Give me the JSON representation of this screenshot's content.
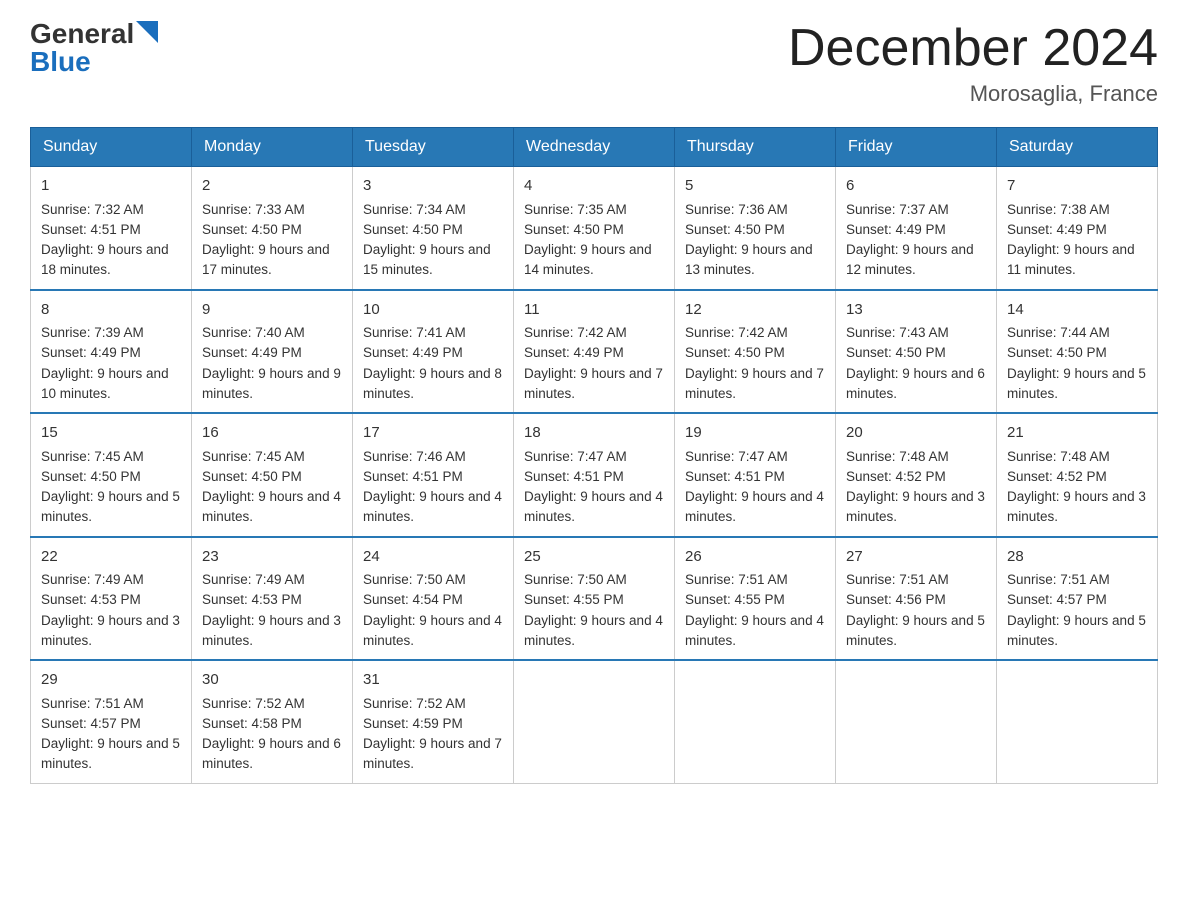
{
  "header": {
    "logo_general": "General",
    "logo_blue": "Blue",
    "month_title": "December 2024",
    "location": "Morosaglia, France"
  },
  "days_of_week": [
    "Sunday",
    "Monday",
    "Tuesday",
    "Wednesday",
    "Thursday",
    "Friday",
    "Saturday"
  ],
  "weeks": [
    [
      {
        "day": "1",
        "sunrise": "7:32 AM",
        "sunset": "4:51 PM",
        "daylight": "9 hours and 18 minutes."
      },
      {
        "day": "2",
        "sunrise": "7:33 AM",
        "sunset": "4:50 PM",
        "daylight": "9 hours and 17 minutes."
      },
      {
        "day": "3",
        "sunrise": "7:34 AM",
        "sunset": "4:50 PM",
        "daylight": "9 hours and 15 minutes."
      },
      {
        "day": "4",
        "sunrise": "7:35 AM",
        "sunset": "4:50 PM",
        "daylight": "9 hours and 14 minutes."
      },
      {
        "day": "5",
        "sunrise": "7:36 AM",
        "sunset": "4:50 PM",
        "daylight": "9 hours and 13 minutes."
      },
      {
        "day": "6",
        "sunrise": "7:37 AM",
        "sunset": "4:49 PM",
        "daylight": "9 hours and 12 minutes."
      },
      {
        "day": "7",
        "sunrise": "7:38 AM",
        "sunset": "4:49 PM",
        "daylight": "9 hours and 11 minutes."
      }
    ],
    [
      {
        "day": "8",
        "sunrise": "7:39 AM",
        "sunset": "4:49 PM",
        "daylight": "9 hours and 10 minutes."
      },
      {
        "day": "9",
        "sunrise": "7:40 AM",
        "sunset": "4:49 PM",
        "daylight": "9 hours and 9 minutes."
      },
      {
        "day": "10",
        "sunrise": "7:41 AM",
        "sunset": "4:49 PM",
        "daylight": "9 hours and 8 minutes."
      },
      {
        "day": "11",
        "sunrise": "7:42 AM",
        "sunset": "4:49 PM",
        "daylight": "9 hours and 7 minutes."
      },
      {
        "day": "12",
        "sunrise": "7:42 AM",
        "sunset": "4:50 PM",
        "daylight": "9 hours and 7 minutes."
      },
      {
        "day": "13",
        "sunrise": "7:43 AM",
        "sunset": "4:50 PM",
        "daylight": "9 hours and 6 minutes."
      },
      {
        "day": "14",
        "sunrise": "7:44 AM",
        "sunset": "4:50 PM",
        "daylight": "9 hours and 5 minutes."
      }
    ],
    [
      {
        "day": "15",
        "sunrise": "7:45 AM",
        "sunset": "4:50 PM",
        "daylight": "9 hours and 5 minutes."
      },
      {
        "day": "16",
        "sunrise": "7:45 AM",
        "sunset": "4:50 PM",
        "daylight": "9 hours and 4 minutes."
      },
      {
        "day": "17",
        "sunrise": "7:46 AM",
        "sunset": "4:51 PM",
        "daylight": "9 hours and 4 minutes."
      },
      {
        "day": "18",
        "sunrise": "7:47 AM",
        "sunset": "4:51 PM",
        "daylight": "9 hours and 4 minutes."
      },
      {
        "day": "19",
        "sunrise": "7:47 AM",
        "sunset": "4:51 PM",
        "daylight": "9 hours and 4 minutes."
      },
      {
        "day": "20",
        "sunrise": "7:48 AM",
        "sunset": "4:52 PM",
        "daylight": "9 hours and 3 minutes."
      },
      {
        "day": "21",
        "sunrise": "7:48 AM",
        "sunset": "4:52 PM",
        "daylight": "9 hours and 3 minutes."
      }
    ],
    [
      {
        "day": "22",
        "sunrise": "7:49 AM",
        "sunset": "4:53 PM",
        "daylight": "9 hours and 3 minutes."
      },
      {
        "day": "23",
        "sunrise": "7:49 AM",
        "sunset": "4:53 PM",
        "daylight": "9 hours and 3 minutes."
      },
      {
        "day": "24",
        "sunrise": "7:50 AM",
        "sunset": "4:54 PM",
        "daylight": "9 hours and 4 minutes."
      },
      {
        "day": "25",
        "sunrise": "7:50 AM",
        "sunset": "4:55 PM",
        "daylight": "9 hours and 4 minutes."
      },
      {
        "day": "26",
        "sunrise": "7:51 AM",
        "sunset": "4:55 PM",
        "daylight": "9 hours and 4 minutes."
      },
      {
        "day": "27",
        "sunrise": "7:51 AM",
        "sunset": "4:56 PM",
        "daylight": "9 hours and 5 minutes."
      },
      {
        "day": "28",
        "sunrise": "7:51 AM",
        "sunset": "4:57 PM",
        "daylight": "9 hours and 5 minutes."
      }
    ],
    [
      {
        "day": "29",
        "sunrise": "7:51 AM",
        "sunset": "4:57 PM",
        "daylight": "9 hours and 5 minutes."
      },
      {
        "day": "30",
        "sunrise": "7:52 AM",
        "sunset": "4:58 PM",
        "daylight": "9 hours and 6 minutes."
      },
      {
        "day": "31",
        "sunrise": "7:52 AM",
        "sunset": "4:59 PM",
        "daylight": "9 hours and 7 minutes."
      },
      null,
      null,
      null,
      null
    ]
  ]
}
